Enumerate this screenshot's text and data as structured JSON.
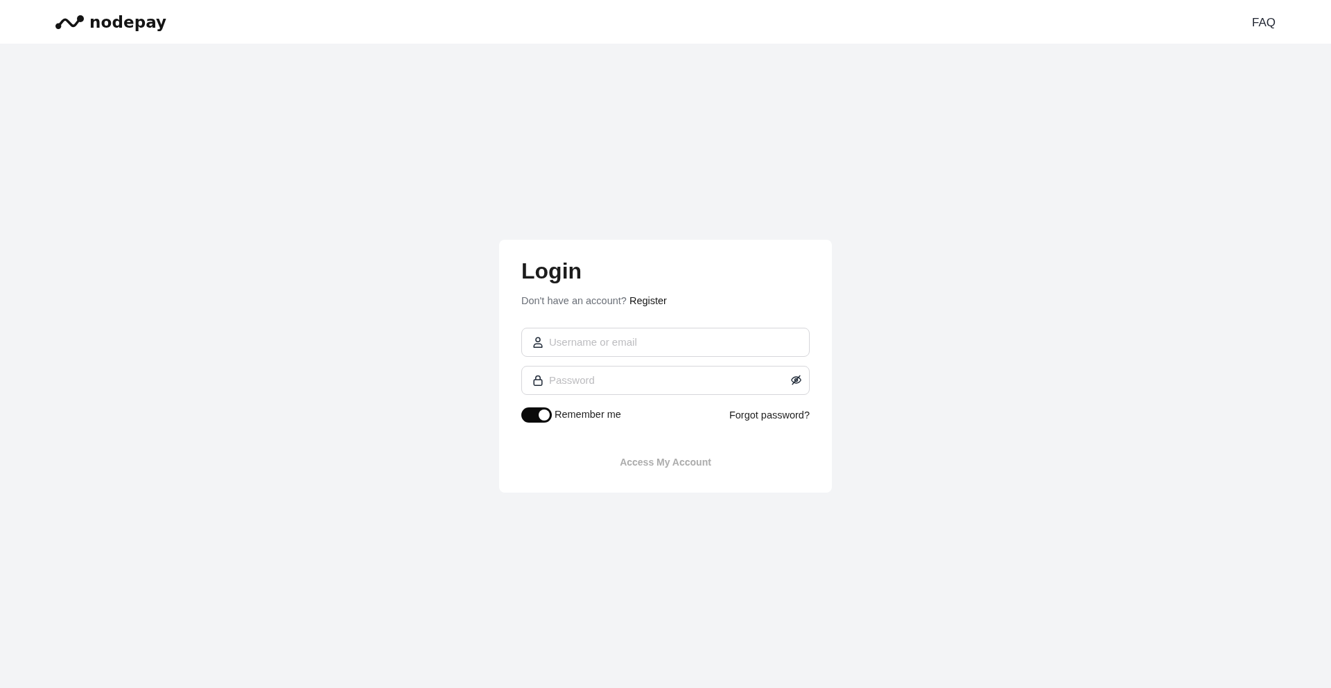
{
  "header": {
    "logo": {
      "text": "nodepay"
    },
    "nav": [
      {
        "label": "FAQ"
      }
    ]
  },
  "login": {
    "title": "Login",
    "prompt": "Don't have an account?",
    "register_link": "Register",
    "fields": [
      {
        "kind": "text",
        "placeholder": "Username or email"
      },
      {
        "kind": "password",
        "placeholder": "Password",
        "revealed": false
      }
    ],
    "remember": {
      "label": "Remember me",
      "on": true
    },
    "forgot_link": "Forgot password?",
    "submit": {
      "label": "Access My Account",
      "disabled": true
    }
  }
}
